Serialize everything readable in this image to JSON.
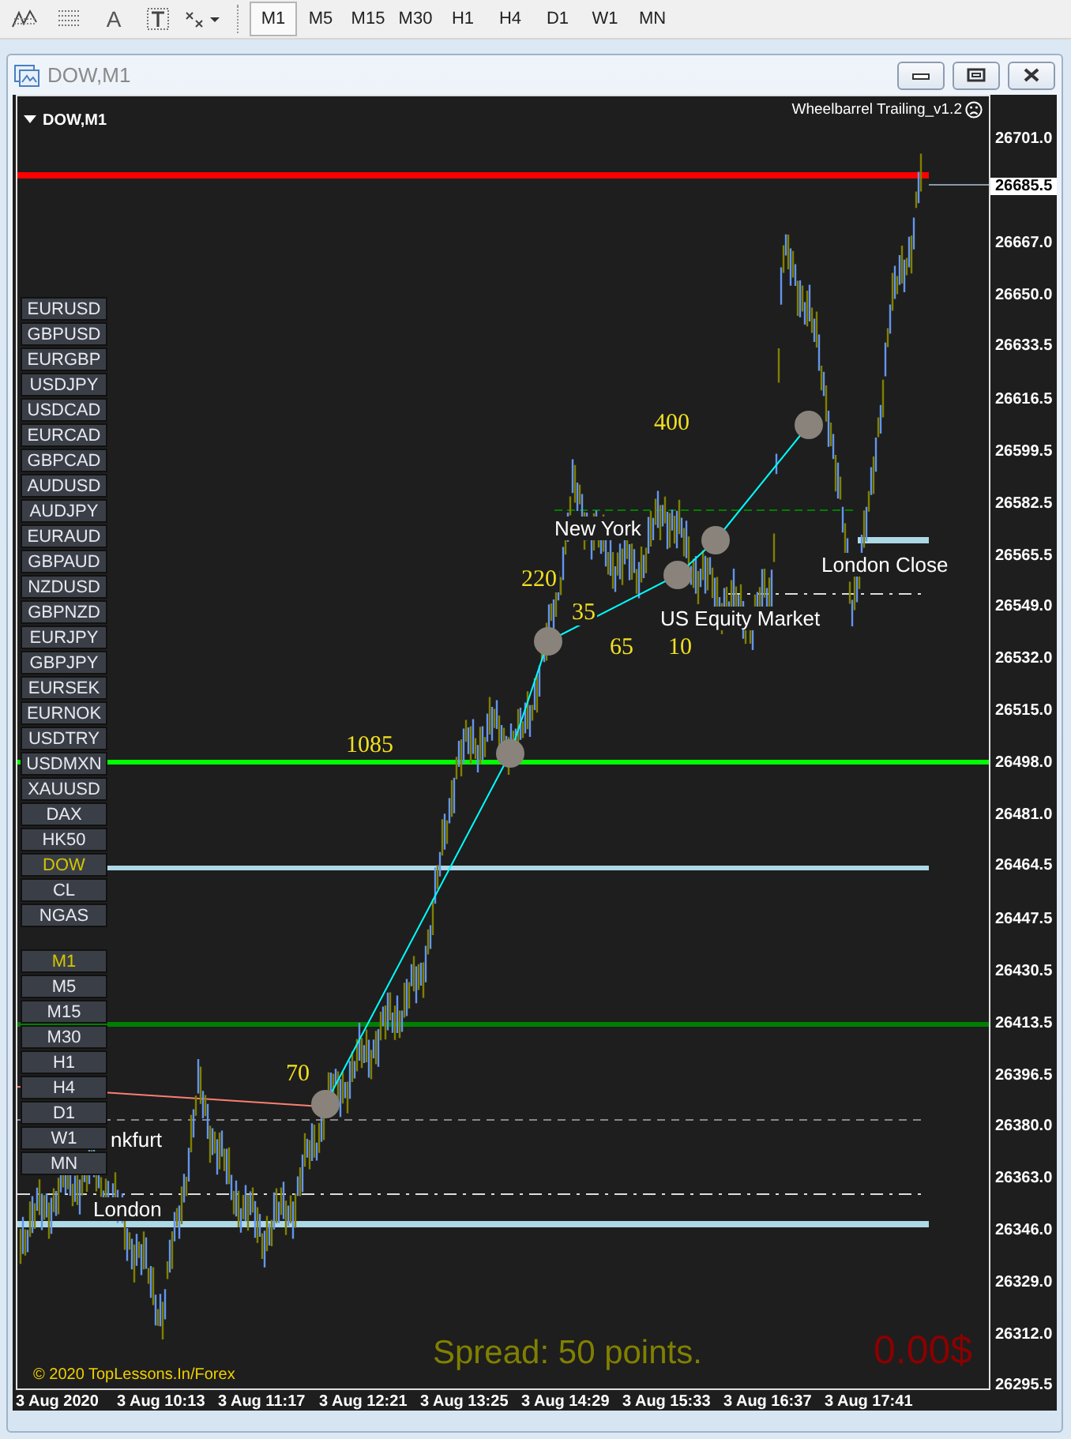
{
  "toolbar": {
    "text_tool": "A",
    "timeframes": [
      {
        "label": "M1",
        "selected": true
      },
      {
        "label": "M5",
        "selected": false
      },
      {
        "label": "M15",
        "selected": false
      },
      {
        "label": "M30",
        "selected": false
      },
      {
        "label": "H1",
        "selected": false
      },
      {
        "label": "H4",
        "selected": false
      },
      {
        "label": "D1",
        "selected": false
      },
      {
        "label": "W1",
        "selected": false
      },
      {
        "label": "MN",
        "selected": false
      }
    ]
  },
  "window": {
    "title": "DOW,M1"
  },
  "chart": {
    "header": "DOW,M1",
    "indicator": "Wheelbarrel Trailing_v1.2",
    "symbols": [
      {
        "label": "EURUSD",
        "selected": false
      },
      {
        "label": "GBPUSD",
        "selected": false
      },
      {
        "label": "EURGBP",
        "selected": false
      },
      {
        "label": "USDJPY",
        "selected": false
      },
      {
        "label": "USDCAD",
        "selected": false
      },
      {
        "label": "EURCAD",
        "selected": false
      },
      {
        "label": "GBPCAD",
        "selected": false
      },
      {
        "label": "AUDUSD",
        "selected": false
      },
      {
        "label": "AUDJPY",
        "selected": false
      },
      {
        "label": "EURAUD",
        "selected": false
      },
      {
        "label": "GBPAUD",
        "selected": false
      },
      {
        "label": "NZDUSD",
        "selected": false
      },
      {
        "label": "GBPNZD",
        "selected": false
      },
      {
        "label": "EURJPY",
        "selected": false
      },
      {
        "label": "GBPJPY",
        "selected": false
      },
      {
        "label": "EURSEK",
        "selected": false
      },
      {
        "label": "EURNOK",
        "selected": false
      },
      {
        "label": "USDTRY",
        "selected": false
      },
      {
        "label": "USDMXN",
        "selected": false
      },
      {
        "label": "XAUUSD",
        "selected": false
      },
      {
        "label": "DAX",
        "selected": false
      },
      {
        "label": "HK50",
        "selected": false
      },
      {
        "label": "DOW",
        "selected": true
      },
      {
        "label": "CL",
        "selected": false
      },
      {
        "label": "NGAS",
        "selected": false
      }
    ],
    "timeframes": [
      {
        "label": "M1",
        "selected": true
      },
      {
        "label": "M5",
        "selected": false
      },
      {
        "label": "M15",
        "selected": false
      },
      {
        "label": "M30",
        "selected": false
      },
      {
        "label": "H1",
        "selected": false
      },
      {
        "label": "H4",
        "selected": false
      },
      {
        "label": "D1",
        "selected": false
      },
      {
        "label": "W1",
        "selected": false
      },
      {
        "label": "MN",
        "selected": false
      }
    ],
    "counts": [
      "400",
      "220",
      "35",
      "65",
      "10",
      "1085",
      "70"
    ],
    "sessions": [
      "New York",
      "US Equity Market",
      "London Close",
      "London",
      "nkfurt"
    ],
    "copyright": "© 2020 TopLessons.In/Forex",
    "spread": "Spread: 50 points.",
    "profit": "0.00$",
    "price_axis": {
      "current": "26685.5",
      "ticks": [
        "26701.0",
        "26667.0",
        "26650.0",
        "26633.5",
        "26616.5",
        "26599.5",
        "26582.5",
        "26565.5",
        "26549.0",
        "26532.0",
        "26515.0",
        "26498.0",
        "26481.0",
        "26464.5",
        "26447.5",
        "26430.5",
        "26413.5",
        "26396.5",
        "26380.0",
        "26363.0",
        "26346.0",
        "26329.0",
        "26312.0",
        "26295.5"
      ]
    },
    "time_axis": [
      "3 Aug 2020",
      "3 Aug 10:13",
      "3 Aug 11:17",
      "3 Aug 12:21",
      "3 Aug 13:25",
      "3 Aug 14:29",
      "3 Aug 15:33",
      "3 Aug 16:37",
      "3 Aug 17:41"
    ]
  }
}
